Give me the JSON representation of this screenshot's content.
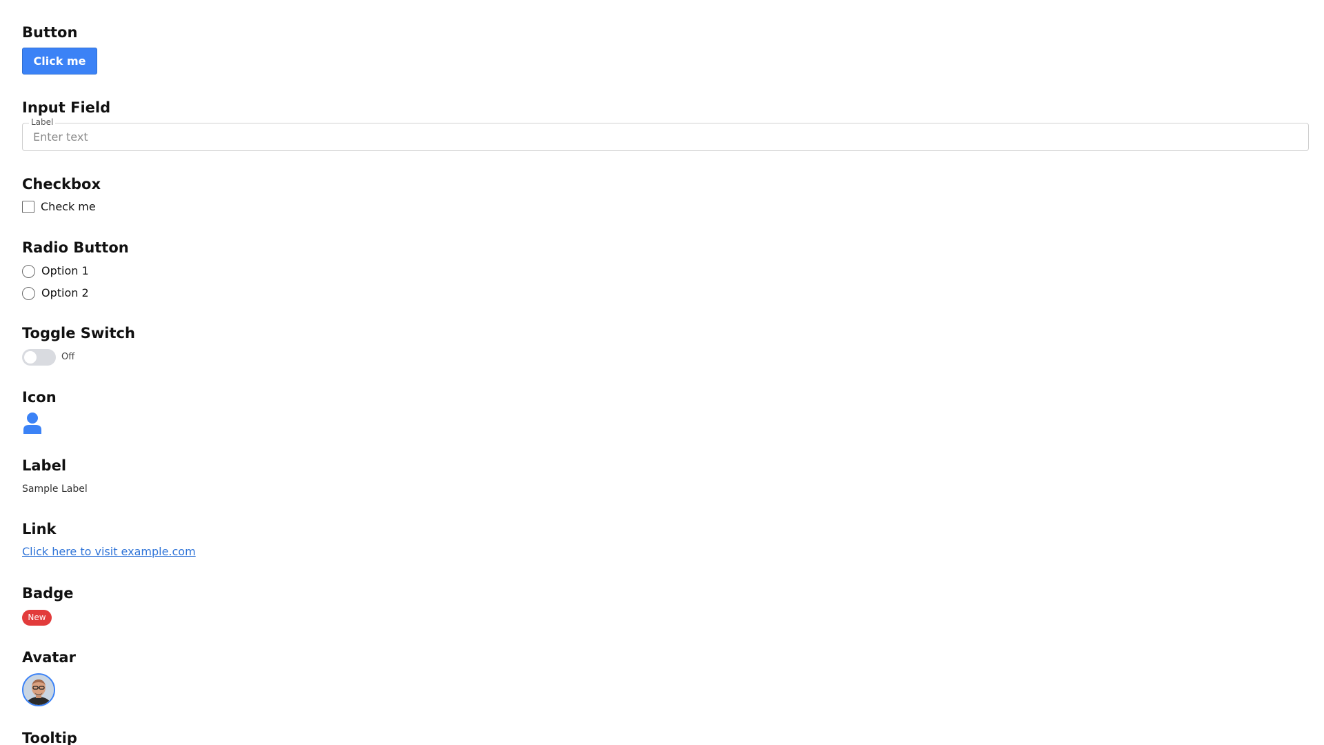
{
  "sections": {
    "button": {
      "title": "Button",
      "label": "Click me"
    },
    "input": {
      "title": "Input Field",
      "field_label": "Label",
      "placeholder": "Enter text",
      "value": ""
    },
    "checkbox": {
      "title": "Checkbox",
      "label": "Check me",
      "checked": false
    },
    "radio": {
      "title": "Radio Button",
      "options": [
        "Option 1",
        "Option 2"
      ],
      "selected": null
    },
    "toggle": {
      "title": "Toggle Switch",
      "state_label": "Off",
      "on": false
    },
    "icon": {
      "title": "Icon",
      "icon": "user-icon",
      "color": "#3b82f6"
    },
    "label": {
      "title": "Label",
      "text": "Sample Label"
    },
    "link": {
      "title": "Link",
      "text": "Click here to visit example.com"
    },
    "badge": {
      "title": "Badge",
      "text": "New",
      "color": "#e23b3b"
    },
    "avatar": {
      "title": "Avatar",
      "image": "person-photo",
      "border_color": "#3b82f6"
    },
    "tooltip": {
      "title": "Tooltip"
    }
  },
  "colors": {
    "accent": "#3b82f6",
    "link": "#2f74d8",
    "badge": "#e23b3b",
    "toggle_off_track": "#d9dbe0"
  }
}
